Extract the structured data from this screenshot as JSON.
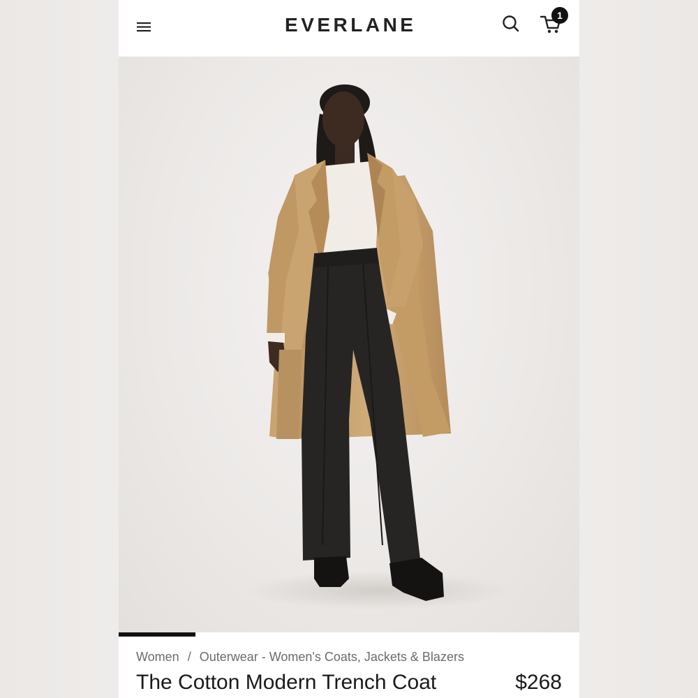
{
  "header": {
    "brand": "EVERLANE",
    "cart_count": "1",
    "icons": {
      "menu": "hamburger-menu-icon",
      "search": "search-icon",
      "cart": "cart-icon"
    }
  },
  "gallery": {
    "image_progress": 0.167
  },
  "product": {
    "breadcrumb": [
      "Women",
      "Outerwear - Women's Coats, Jackets & Blazers"
    ],
    "breadcrumb_separator": "/",
    "title": "The Cotton Modern Trench Coat",
    "price": "$268"
  },
  "colors": {
    "text_primary": "#1a1a1a",
    "text_secondary": "#6b6b6b",
    "badge": "#111111",
    "coat": "#c6a16c",
    "trousers": "#262524"
  }
}
